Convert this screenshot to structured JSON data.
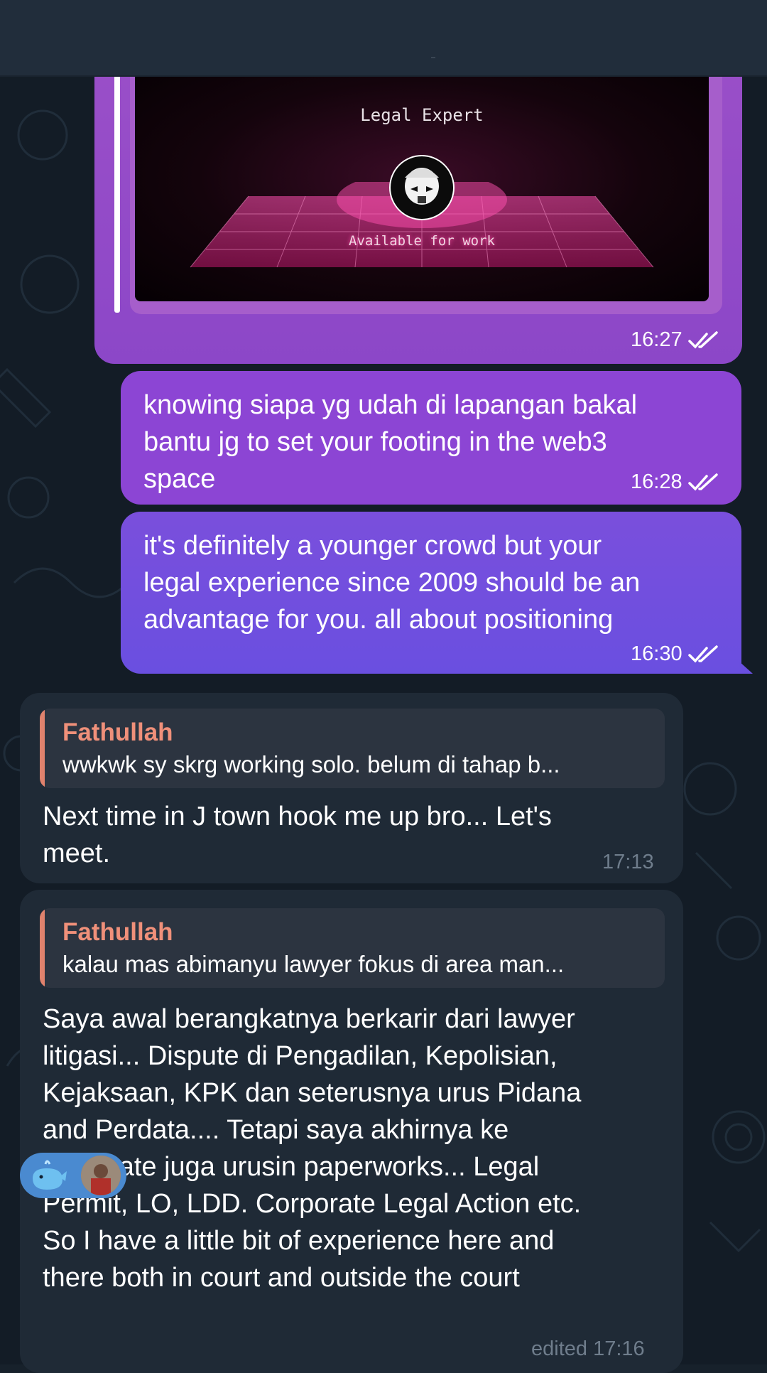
{
  "messages": {
    "m1": {
      "preview": {
        "title": "Legal Expert",
        "subtitle": "Available for work"
      },
      "time": "16:27"
    },
    "m2": {
      "lines": [
        "knowing siapa yg udah di lapangan bakal",
        "bantu jg to set your footing in the web3",
        "space"
      ],
      "time": "16:28"
    },
    "m3": {
      "lines": [
        "it's definitely a younger crowd but your",
        "legal experience since 2009 should be an",
        "advantage for you. all about positioning"
      ],
      "time": "16:30"
    },
    "m4": {
      "quote_name": "Fathullah",
      "quote_text": "wwkwk sy skrg working solo. belum di tahap b...",
      "lines": [
        "Next time in J town hook me up bro... Let's",
        "meet."
      ],
      "time": "17:13"
    },
    "m5": {
      "quote_name": "Fathullah",
      "quote_text": "kalau mas abimanyu lawyer fokus di area man...",
      "lines": [
        "Saya awal berangkatnya berkarir dari lawyer",
        "litigasi... Dispute di Pengadilan, Kepolisian,",
        "Kejaksaan, KPK dan seterusnya urus Pidana",
        "and Perdata.... Tetapi saya akhirnya ke",
        "corporate juga urusin paperworks... Legal",
        "Permit, LO, LDD. Corporate Legal Action etc.",
        "So I have a little bit of experience here and",
        "there both in court and outside the court"
      ],
      "time": "edited 17:16",
      "reaction_icon": "whale-emoji-icon"
    }
  },
  "colors": {
    "background": "#131c26",
    "outgoing_bubble": "#8c45d4",
    "incoming_bubble": "#1f2a36",
    "quote_name": "#f0907a",
    "header": "#212d3b"
  }
}
